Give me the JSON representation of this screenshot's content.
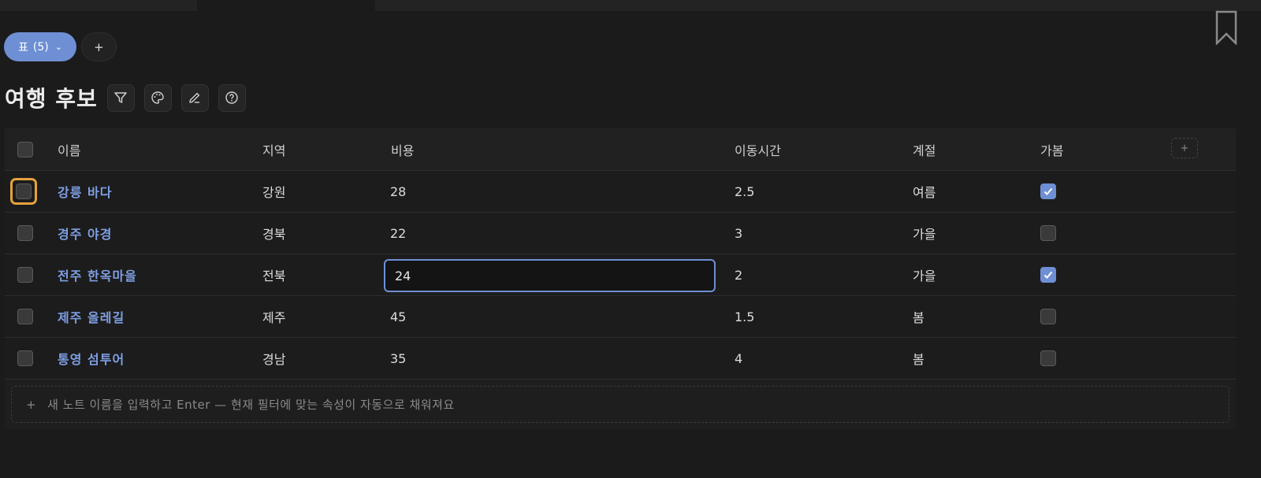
{
  "view": {
    "label": "표",
    "count": "(5)",
    "chevron": "⌄",
    "add_label": "+"
  },
  "title": "여행 후보",
  "toolbar": {
    "icons": [
      "filter-icon",
      "palette-icon",
      "pencil-icon",
      "help-icon"
    ]
  },
  "table": {
    "columns": [
      "이름",
      "지역",
      "비용",
      "이동시간",
      "계절",
      "가봄"
    ],
    "add_column_label": "+",
    "rows": [
      {
        "name": "강릉 바다",
        "region": "강원",
        "cost": "28",
        "time": "2.5",
        "season": "여름",
        "visited": true,
        "selected": false,
        "focused": true
      },
      {
        "name": "경주 야경",
        "region": "경북",
        "cost": "22",
        "time": "3",
        "season": "가을",
        "visited": false,
        "selected": false,
        "focused": false
      },
      {
        "name": "전주 한옥마을",
        "region": "전북",
        "cost": "24",
        "time": "2",
        "season": "가을",
        "visited": true,
        "selected": false,
        "focused": false,
        "editing_cost": true
      },
      {
        "name": "제주 올레길",
        "region": "제주",
        "cost": "45",
        "time": "1.5",
        "season": "봄",
        "visited": false,
        "selected": false,
        "focused": false
      },
      {
        "name": "통영 섬투어",
        "region": "경남",
        "cost": "35",
        "time": "4",
        "season": "봄",
        "visited": false,
        "selected": false,
        "focused": false
      }
    ]
  },
  "new_note": {
    "plus": "+",
    "placeholder": "새 노트 이름을 입력하고 Enter — 현재 필터에 맞는 속성이 자동으로 채워져요"
  },
  "colors": {
    "accent": "#6e8fd4",
    "link": "#7f9fe3",
    "focus": "#e6a23c",
    "background": "#1b1b1b"
  }
}
